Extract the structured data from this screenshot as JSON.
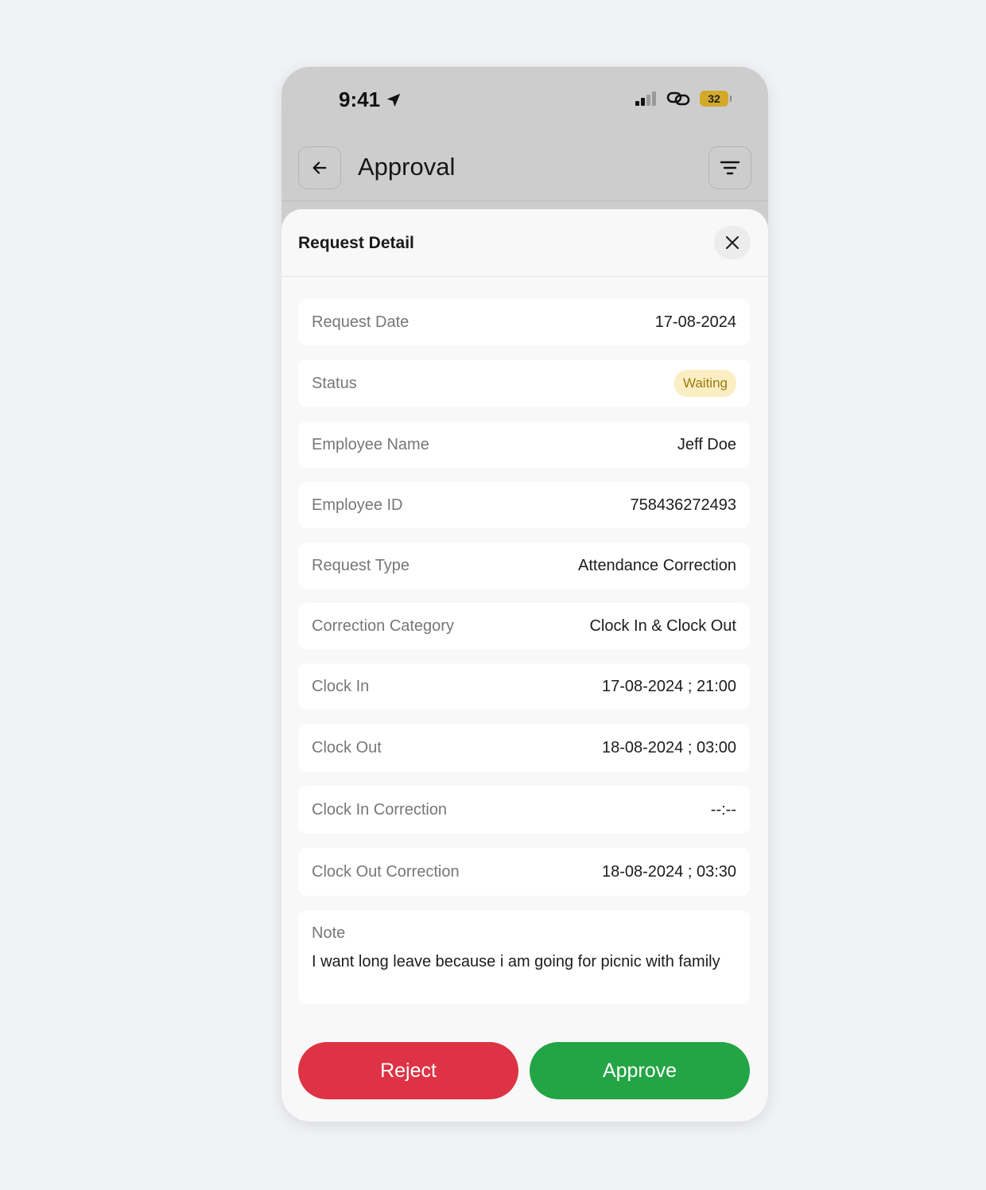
{
  "status_bar": {
    "time": "9:41",
    "battery": "32"
  },
  "header": {
    "title": "Approval"
  },
  "sheet": {
    "title": "Request Detail",
    "rows": [
      {
        "label": "Request Date",
        "value": "17-08-2024"
      },
      {
        "label": "Status",
        "value": "Waiting"
      },
      {
        "label": "Employee Name",
        "value": "Jeff Doe"
      },
      {
        "label": "Employee ID",
        "value": "758436272493"
      },
      {
        "label": "Request Type",
        "value": "Attendance Correction"
      },
      {
        "label": "Correction Category",
        "value": "Clock In & Clock Out"
      },
      {
        "label": "Clock In",
        "value": "17-08-2024 ; 21:00"
      },
      {
        "label": "Clock Out",
        "value": "18-08-2024 ; 03:00"
      },
      {
        "label": "Clock In Correction",
        "value": "--:--"
      },
      {
        "label": "Clock Out Correction",
        "value": "18-08-2024 ; 03:30"
      }
    ],
    "note": {
      "label": "Note",
      "text": "I want long leave because i am going for picnic with family"
    }
  },
  "actions": {
    "reject_label": "Reject",
    "approve_label": "Approve"
  },
  "colors": {
    "reject": "#dd3344",
    "approve": "#23a545",
    "status_badge_bg": "#fbeec4",
    "status_badge_text": "#9b7a0b"
  },
  "icons": {
    "back": "arrow-left-icon",
    "filter": "filter-icon",
    "close": "close-icon",
    "location": "location-arrow-icon",
    "signal": "signal-icon",
    "link": "link-icon"
  }
}
